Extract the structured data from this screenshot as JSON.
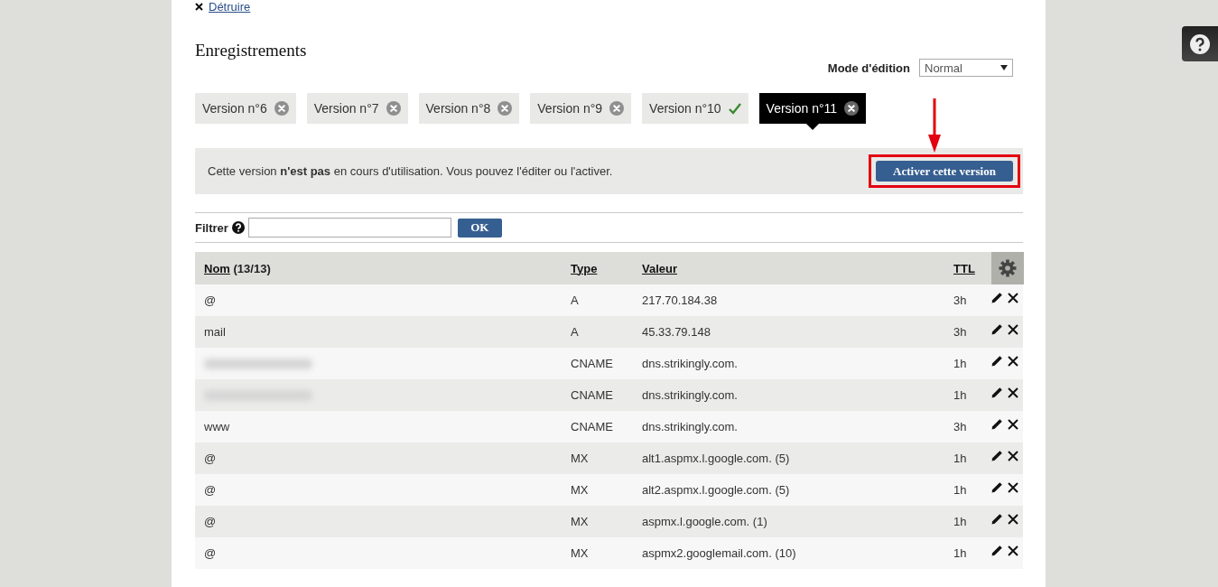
{
  "top_link": {
    "label": "Détruire"
  },
  "heading": "Enregistrements",
  "edit_mode": {
    "label": "Mode d'édition",
    "value": "Normal"
  },
  "version_tabs": [
    {
      "label": "Version n°6",
      "kind": "removable",
      "selected": false
    },
    {
      "label": "Version n°7",
      "kind": "removable",
      "selected": false
    },
    {
      "label": "Version n°8",
      "kind": "removable",
      "selected": false
    },
    {
      "label": "Version n°9",
      "kind": "removable",
      "selected": false
    },
    {
      "label": "Version n°10",
      "kind": "active",
      "selected": false
    },
    {
      "label": "Version n°11",
      "kind": "removable",
      "selected": true
    }
  ],
  "info": {
    "message": "Cette version **n'est pas** en cours d'utilisation. Vous pouvez l'éditer ou l'activer.",
    "button": "Activer cette version",
    "highlighted": true
  },
  "filter": {
    "label": "Filtrer",
    "button": "OK"
  },
  "table": {
    "columns": [
      {
        "label": "Nom",
        "count": "(13/13)"
      },
      {
        "label": "Type"
      },
      {
        "label": "Valeur"
      },
      {
        "label": "TTL"
      }
    ],
    "rows": [
      {
        "name": "@",
        "blurred": false,
        "type": "A",
        "value": "217.70.184.38",
        "ttl": "3h"
      },
      {
        "name": "mail",
        "blurred": false,
        "type": "A",
        "value": "45.33.79.148",
        "ttl": "3h"
      },
      {
        "blurred": true,
        "type": "CNAME",
        "value": "dns.strikingly.com.",
        "ttl": "1h"
      },
      {
        "blurred": true,
        "type": "CNAME",
        "value": "dns.strikingly.com.",
        "ttl": "1h"
      },
      {
        "name": "www",
        "blurred": false,
        "type": "CNAME",
        "value": "dns.strikingly.com.",
        "ttl": "3h"
      },
      {
        "name": "@",
        "blurred": false,
        "type": "MX",
        "value": "alt1.aspmx.l.google.com. (5)",
        "ttl": "1h"
      },
      {
        "name": "@",
        "blurred": false,
        "type": "MX",
        "value": "alt2.aspmx.l.google.com. (5)",
        "ttl": "1h"
      },
      {
        "name": "@",
        "blurred": false,
        "type": "MX",
        "value": "aspmx.l.google.com. (1)",
        "ttl": "1h"
      },
      {
        "name": "@",
        "blurred": false,
        "type": "MX",
        "value": "aspmx2.googlemail.com. (10)",
        "ttl": "1h"
      }
    ]
  }
}
